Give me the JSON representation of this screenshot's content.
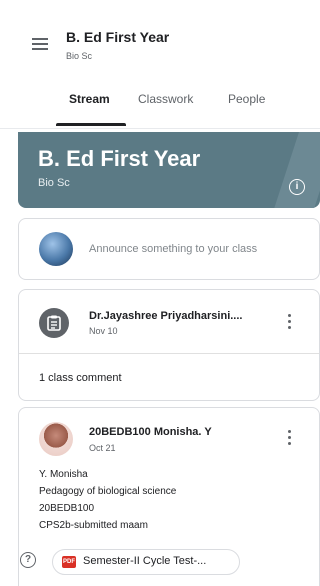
{
  "header": {
    "title": "B. Ed First Year",
    "subtitle": "Bio Sc"
  },
  "tabs": [
    {
      "label": "Stream",
      "active": true
    },
    {
      "label": "Classwork",
      "active": false
    },
    {
      "label": "People",
      "active": false
    }
  ],
  "banner": {
    "title": "B. Ed First Year",
    "subtitle": "Bio Sc",
    "color": "#5b7a85"
  },
  "announce": {
    "placeholder": "Announce something to your class"
  },
  "posts": [
    {
      "author": "Dr.Jayashree Priyadharsini....",
      "date": "Nov 10",
      "comments": "1 class comment"
    },
    {
      "author": "20BEDB100 Monisha. Y",
      "date": "Oct 21",
      "lines": [
        "Y. Monisha",
        "Pedagogy of biological science",
        "20BEDB100",
        "CPS2b-submitted maam"
      ],
      "attachment": {
        "badge": "PDF",
        "label": "Semester-II Cycle Test-..."
      }
    }
  ],
  "icons": {
    "menu": "menu-icon",
    "info": "info-icon",
    "help": "help-icon",
    "more": "more-vert-icon",
    "assignment": "assignment-icon",
    "pdf": "pdf-icon"
  }
}
